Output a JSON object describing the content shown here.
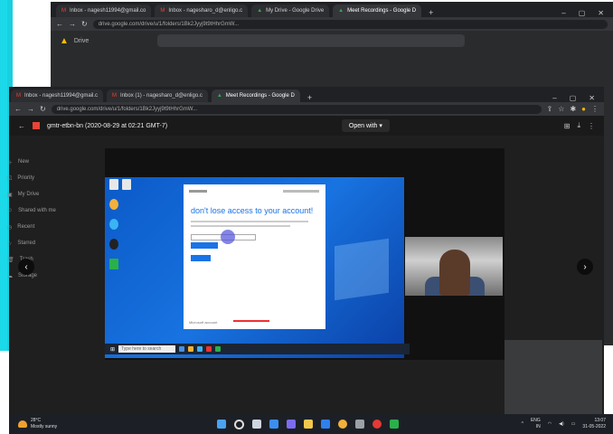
{
  "back_window": {
    "tabs": [
      {
        "label": "Inbox - nagesh11994@gmail.co",
        "active": false
      },
      {
        "label": "Inbox - nagesharo_d@enligo.c",
        "active": false
      },
      {
        "label": "My Drive - Google Drive",
        "active": false
      },
      {
        "label": "Meet Recordings - Google D",
        "active": true
      }
    ],
    "url": "drive.google.com/drive/u/1/folders/1Bk2Jyyj9t9tHhrGmW...",
    "app_title": "Drive"
  },
  "front_window": {
    "tabs": [
      {
        "label": "Inbox - nagesh11994@gmail.c",
        "active": false
      },
      {
        "label": "Inbox (1) - nagesharo_d@enligo.c",
        "active": false
      },
      {
        "label": "Meet Recordings - Google D",
        "active": true
      }
    ],
    "url": "drive.google.com/drive/u/1/folders/1Bk2Jyyj9t9tHhrGmW...",
    "file_name": "gmtr-etbn-bn (2020-08-29 at 02:21 GMT-7)",
    "open_with_label": "Open with",
    "sidebar_items": [
      "New",
      "Priority",
      "My Drive",
      "Shared with me",
      "Recent",
      "Starred",
      "Trash",
      "Storage"
    ]
  },
  "dialog": {
    "title": "don't lose access to your account!",
    "footer": "Microsoft account"
  },
  "taskbar": {
    "search_placeholder": "Type here to search",
    "weather_temp": "28°C",
    "weather_text": "Mostly sunny",
    "language": "ENG",
    "language_sub": "IN",
    "time": "13:07",
    "date": "31-05-2022"
  },
  "colors": {
    "accent": "#1a73e8",
    "desktop_blue": "#1873e0",
    "cyan_edge": "#17d0e0"
  }
}
